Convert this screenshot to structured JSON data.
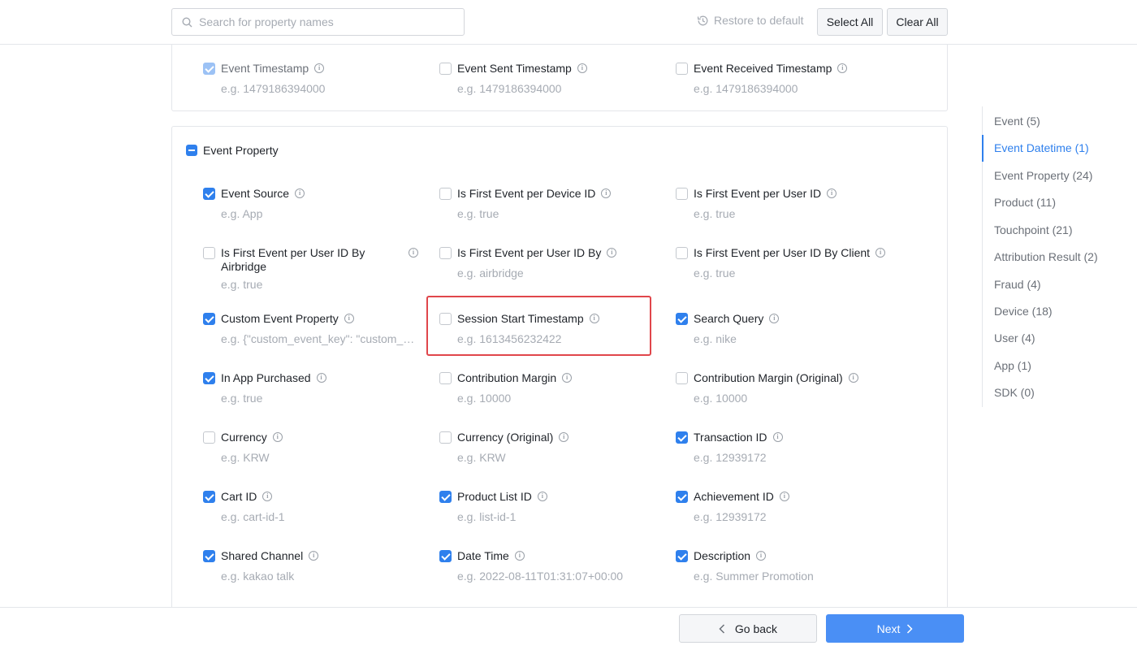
{
  "search": {
    "placeholder": "Search for property names"
  },
  "toolbar": {
    "restore_label": "Restore to default",
    "select_all_label": "Select All",
    "clear_all_label": "Clear All"
  },
  "datetime_items": [
    {
      "label": "Event Timestamp",
      "example": "e.g. 1479186394000",
      "state": "checked-disabled"
    },
    {
      "label": "Event Sent Timestamp",
      "example": "e.g. 1479186394000",
      "state": "unchecked"
    },
    {
      "label": "Event Received Timestamp",
      "example": "e.g. 1479186394000",
      "state": "unchecked"
    }
  ],
  "event_property": {
    "title": "Event Property",
    "items": [
      {
        "label": "Event Source",
        "example": "e.g. App",
        "checked": true
      },
      {
        "label": "Is First Event per Device ID",
        "example": "e.g. true",
        "checked": false
      },
      {
        "label": "Is First Event per User ID",
        "example": "e.g. true",
        "checked": false
      },
      {
        "label": "Is First Event per User ID By Airbridge",
        "example": "e.g. true",
        "checked": false
      },
      {
        "label": "Is First Event per User ID By",
        "example": "e.g. airbridge",
        "checked": false
      },
      {
        "label": "Is First Event per User ID By Client",
        "example": "e.g. true",
        "checked": false
      },
      {
        "label": "Custom Event Property",
        "example": "e.g. {\"custom_event_key\": \"custom_event_value\"}",
        "checked": true
      },
      {
        "label": "Session Start Timestamp",
        "example": "e.g. 1613456232422",
        "checked": false
      },
      {
        "label": "Search Query",
        "example": "e.g. nike",
        "checked": true
      },
      {
        "label": "In App Purchased",
        "example": "e.g. true",
        "checked": true
      },
      {
        "label": "Contribution Margin",
        "example": "e.g. 10000",
        "checked": false
      },
      {
        "label": "Contribution Margin (Original)",
        "example": "e.g. 10000",
        "checked": false
      },
      {
        "label": "Currency",
        "example": "e.g. KRW",
        "checked": false
      },
      {
        "label": "Currency (Original)",
        "example": "e.g. KRW",
        "checked": false
      },
      {
        "label": "Transaction ID",
        "example": "e.g. 12939172",
        "checked": true
      },
      {
        "label": "Cart ID",
        "example": "e.g. cart-id-1",
        "checked": true
      },
      {
        "label": "Product List ID",
        "example": "e.g. list-id-1",
        "checked": true
      },
      {
        "label": "Achievement ID",
        "example": "e.g. 12939172",
        "checked": true
      },
      {
        "label": "Shared Channel",
        "example": "e.g. kakao talk",
        "checked": true
      },
      {
        "label": "Date Time",
        "example": "e.g. 2022-08-11T01:31:07+00:00",
        "checked": true
      },
      {
        "label": "Description",
        "example": "e.g. Summer Promotion",
        "checked": true
      }
    ]
  },
  "sidenav": [
    {
      "label": "Event (5)",
      "active": false
    },
    {
      "label": "Event Datetime (1)",
      "active": true
    },
    {
      "label": "Event Property (24)",
      "active": false
    },
    {
      "label": "Product (11)",
      "active": false
    },
    {
      "label": "Touchpoint (21)",
      "active": false
    },
    {
      "label": "Attribution Result (2)",
      "active": false
    },
    {
      "label": "Fraud (4)",
      "active": false
    },
    {
      "label": "Device (18)",
      "active": false
    },
    {
      "label": "User (4)",
      "active": false
    },
    {
      "label": "App (1)",
      "active": false
    },
    {
      "label": "SDK (0)",
      "active": false
    }
  ],
  "footer": {
    "back_label": "Go back",
    "next_label": "Next"
  },
  "colors": {
    "accent": "#2f80ed",
    "next_button": "#4a8ff5",
    "highlight": "#e0464b"
  },
  "icons": {
    "search": "search-icon",
    "restore": "restore-icon",
    "info": "info-icon",
    "back": "chevron-left-icon",
    "next": "chevron-right-icon"
  }
}
